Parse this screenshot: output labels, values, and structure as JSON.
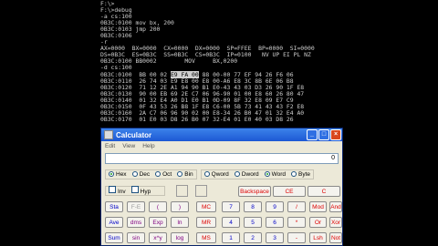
{
  "console": {
    "lines": [
      "F:\\>",
      "",
      "F:\\>debug",
      "-a cs:100",
      "0B3C:0100 mov bx, 200",
      "0B3C:0103 jmp 200",
      "0B3C:0106",
      "-r",
      "AX=0000  BX=0000  CX=0000  DX=0000  SP=FFEE  BP=0000  SI=0000",
      "DS=0B3C  ES=0B3C  SS=0B3C  CS=0B3C  IP=0100   NV UP EI PL NZ",
      "0B3C:0100 BB0002        MOV     BX,0200",
      "-d cs:100",
      "0B3C:0100  BB 00 02 E9 FA 00 88 00-00 77 EF 94 26 F6 06",
      "0B3C:0110  26 74 03 E9 E8 00 E8 00-A6 E8 3C 8B 6E 06 B8",
      "0B3C:0120  71 12 2E A1 94 90 B1 E0-43 43 03 D3 26 90 1F E8",
      "0B3C:0130  90 00 EB 69 2E C7 06 96-90 01 00 E8 60 26 80 47",
      "0B3C:0140  01 32 E4 A0 D1 E0 B1 0D-09 8F 32 E8 09 E7 C9",
      "0B3C:0150  0F 43 53 26 B8 1F E8 C6-00 5B 73 41 43 43 F2 E8",
      "0B3C:0160  2A C7 06 96 90 02 00 E8-34 26 B0 47 01 32 E4 A0",
      "0B3C:0170  01 E0 03 D8 26 B0 07 32-E4 01 E0 40 03 D8 26"
    ],
    "highlight_row": 12,
    "highlight_text": "E9 FA 00"
  },
  "calculator": {
    "title": "Calculator",
    "menu": [
      "Edit",
      "View",
      "Help"
    ],
    "display_value": "0",
    "base_options": [
      "Hex",
      "Dec",
      "Oct",
      "Bin"
    ],
    "base_selected": "Hex",
    "word_options": [
      "Qword",
      "Dword",
      "Word",
      "Byte"
    ],
    "word_selected": "Word",
    "inv_label": "Inv",
    "hyp_label": "Hyp",
    "backspace_label": "Backspace",
    "ce_label": "CE",
    "c_label": "C",
    "row1": [
      "Sta",
      "F-E",
      "(",
      ")",
      "MC",
      "7",
      "8",
      "9",
      "/",
      "Mod",
      "And"
    ],
    "row2": [
      "Ave",
      "dms",
      "Exp",
      "ln",
      "MR",
      "4",
      "5",
      "6",
      "*",
      "Or",
      "Xor"
    ],
    "row3": [
      "Sum",
      "sin",
      "x^y",
      "log",
      "MS",
      "1",
      "2",
      "3",
      "-",
      "Lsh",
      "Not"
    ]
  }
}
